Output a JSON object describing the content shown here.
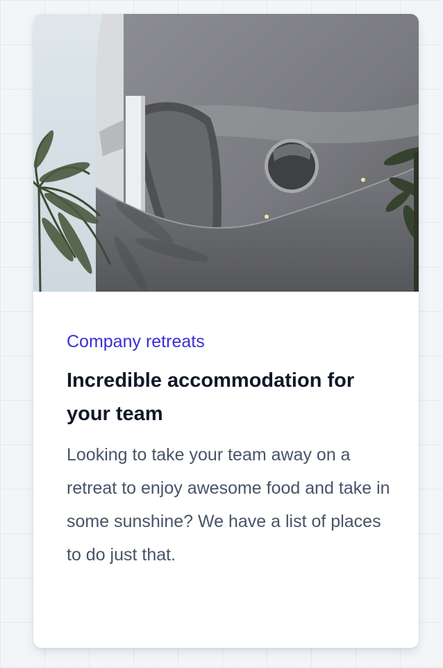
{
  "card": {
    "image": {
      "icon": "building-photo",
      "alt": ""
    },
    "category": "Company retreats",
    "title": "Incredible accommodation for your team",
    "description": "Looking to take your team away on a retreat to enjoy awesome food and take in some sunshine? We have a list of places to do just that."
  },
  "colors": {
    "category": "#3b2ed6",
    "title": "#101828",
    "description": "#475467",
    "page_background": "#f3f6f9"
  }
}
